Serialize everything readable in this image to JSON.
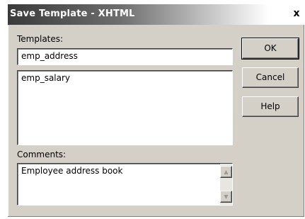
{
  "window": {
    "title": "Save Template - XHTML",
    "close_label": "x"
  },
  "templates": {
    "label": "Templates:",
    "name_value": "emp_address",
    "list_items": [
      "emp_salary"
    ]
  },
  "comments": {
    "label": "Comments:",
    "value": "Employee address book"
  },
  "buttons": {
    "ok": "OK",
    "cancel": "Cancel",
    "help": "Help"
  },
  "scrollbar": {
    "up_glyph": "▲",
    "down_glyph": "▼"
  }
}
